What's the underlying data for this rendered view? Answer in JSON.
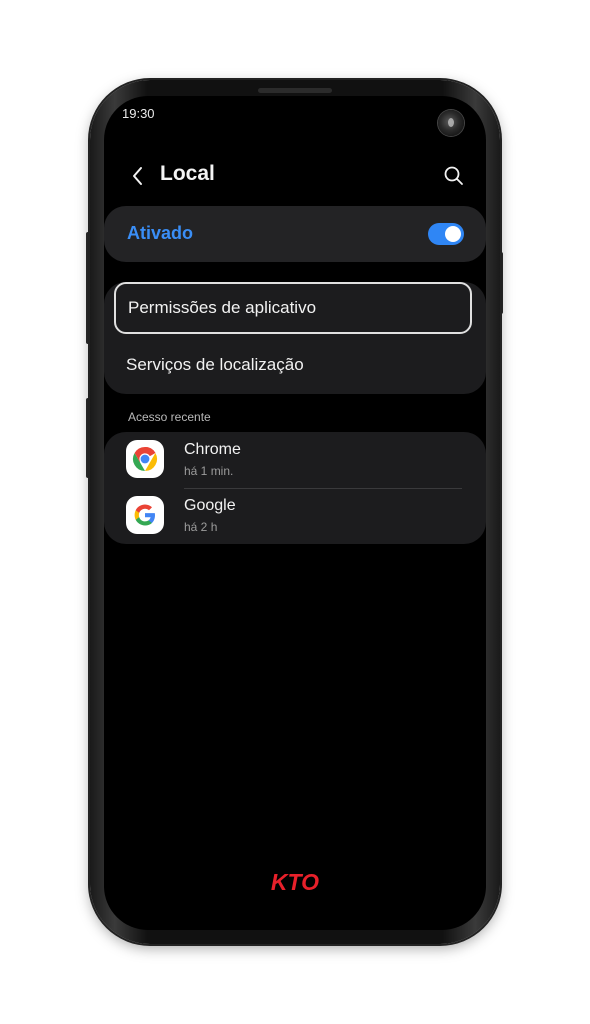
{
  "status_bar": {
    "time": "19:30"
  },
  "header": {
    "title": "Local",
    "back_icon": "chevron-left-icon",
    "search_icon": "search-icon"
  },
  "location_toggle": {
    "label": "Ativado",
    "state": "on",
    "accent_color": "#2f86f5"
  },
  "menu": {
    "items": [
      {
        "label": "Permissões de aplicativo",
        "highlighted": true
      },
      {
        "label": "Serviços de localização",
        "highlighted": false
      }
    ]
  },
  "recent_access": {
    "section_title": "Acesso recente",
    "apps": [
      {
        "name": "Chrome",
        "time": "há 1 min.",
        "icon": "chrome-icon"
      },
      {
        "name": "Google",
        "time": "há 2 h",
        "icon": "google-icon"
      }
    ]
  },
  "brand": {
    "logo_text": "KTO",
    "color": "#e8202a"
  }
}
